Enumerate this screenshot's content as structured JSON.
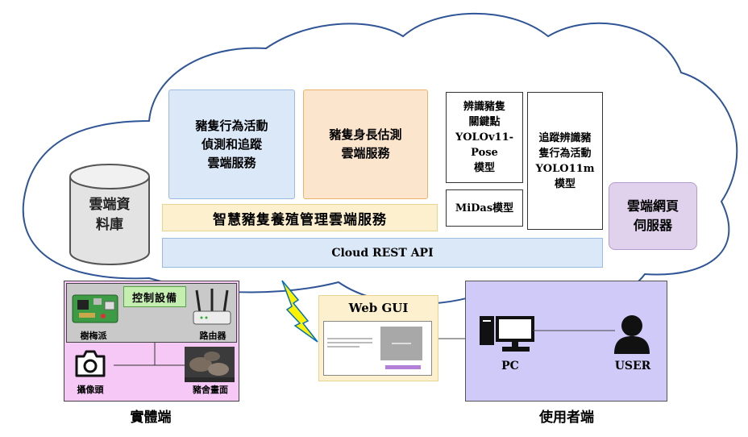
{
  "cloud": {
    "services": {
      "pig_behavior": "豬隻行為活動\n偵測和追蹤\n雲端服務",
      "pig_body_length": "豬隻身長估測\n雲端服務"
    },
    "models": {
      "keypoint": "辨識豬隻\n關鍵點\nYOLOv11-\nPose\n模型",
      "midas": "MiDas模型",
      "tracking": "追蹤辨識豬\n隻行為活動\nYOLO11m\n模型"
    },
    "web_server": "雲端網頁\n伺服器",
    "database": "雲端資\n料庫",
    "management_service": "智慧豬隻養殖管理雲端服務",
    "rest_api": "Cloud REST API"
  },
  "physical": {
    "control_label": "控制設備",
    "raspberry_pi": "樹梅派",
    "router": "路由器",
    "camera": "攝像頭",
    "pen_view": "豬舍畫面",
    "section_title": "實體端"
  },
  "web_gui": {
    "title": "Web GUI"
  },
  "user_side": {
    "pc": "PC",
    "user": "USER",
    "section_title": "使用者端"
  },
  "colors": {
    "cloud_stroke": "#2f5597",
    "lightning": "#fff200",
    "lightning_stroke": "#0070c0"
  }
}
